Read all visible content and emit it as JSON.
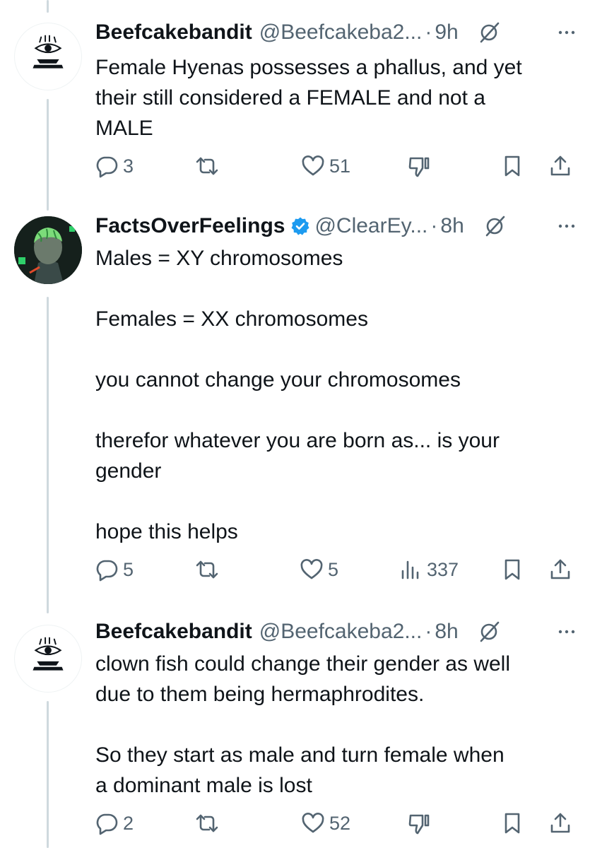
{
  "tweets": [
    {
      "name": "Beefcakebandit",
      "handle": "@Beefcakeba2...",
      "dot": "·",
      "time": "9h",
      "verified": false,
      "avatar_icon": "eye-logo-avatar",
      "text": [
        "Female Hyenas possesses a phallus, and yet",
        "their still considered a FEMALE and not a",
        "MALE"
      ],
      "reply_count": "3",
      "retweet_count": "",
      "like_count": "51",
      "views_count": ""
    },
    {
      "name": "FactsOverFeelings",
      "handle": "@ClearEy...",
      "dot": "·",
      "time": "8h",
      "verified": true,
      "avatar_icon": "brain-avatar",
      "text": [
        "Males = XY chromosomes",
        "",
        "Females = XX chromosomes",
        "",
        "you cannot change your chromosomes",
        "",
        "therefor whatever you are born as... is your",
        "gender",
        "",
        "hope this helps"
      ],
      "reply_count": "5",
      "retweet_count": "",
      "like_count": "5",
      "views_count": "337"
    },
    {
      "name": "Beefcakebandit",
      "handle": "@Beefcakeba2...",
      "dot": "·",
      "time": "8h",
      "verified": false,
      "avatar_icon": "eye-logo-avatar",
      "text": [
        "clown fish could change their gender as well",
        "due to them being hermaphrodites.",
        "",
        "So they start as male and turn female when",
        "a dominant male is lost"
      ],
      "reply_count": "2",
      "retweet_count": "",
      "like_count": "52",
      "views_count": ""
    }
  ],
  "colors": {
    "text": "#0f1419",
    "secondary": "#536471",
    "verified": "#1d9bf0",
    "thread_line": "#cfd9de"
  }
}
